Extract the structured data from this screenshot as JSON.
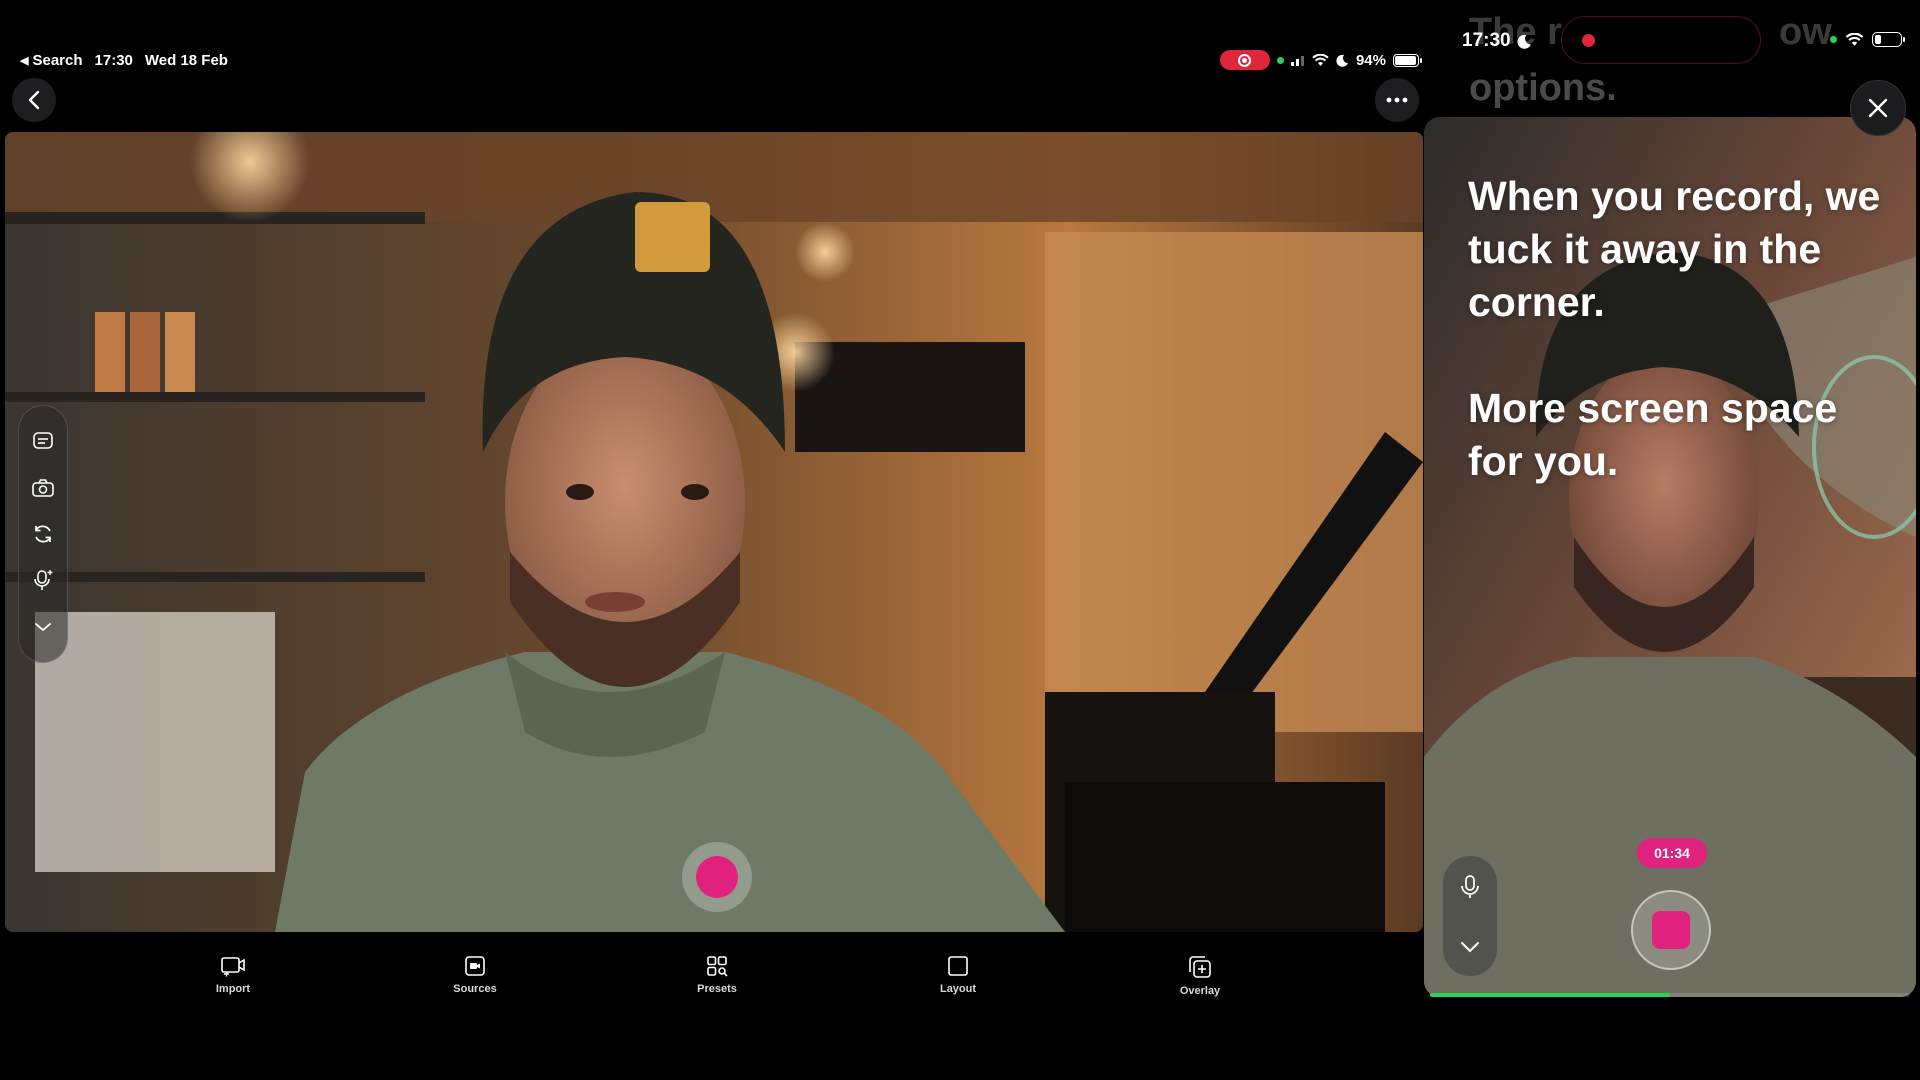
{
  "ipad": {
    "status": {
      "back_app": "Search",
      "time": "17:30",
      "date": "Wed 18 Feb",
      "battery": "94%"
    },
    "record_button_color": "#e0227e",
    "tabs": [
      {
        "label": "Import",
        "icon": "import-video-icon"
      },
      {
        "label": "Sources",
        "icon": "sources-camera-icon"
      },
      {
        "label": "Presets",
        "icon": "presets-grid-icon"
      },
      {
        "label": "Layout",
        "icon": "layout-square-icon"
      },
      {
        "label": "Overlay",
        "icon": "overlay-add-icon"
      }
    ],
    "side_tools": [
      "caption-icon",
      "snapshot-camera-icon",
      "flip-camera-icon",
      "mic-settings-icon",
      "collapse-chevron-icon"
    ]
  },
  "iphone": {
    "status": {
      "time": "17:30"
    },
    "ghost_text": {
      "line1": "The r",
      "line1_end": "ow",
      "line2": "options."
    },
    "onboarding": {
      "paragraph1": "When you record, we tuck it away in the corner.",
      "paragraph2": "More screen space for you."
    },
    "timer": "01:34",
    "progress": 0.5,
    "accent": "#e0227e"
  }
}
